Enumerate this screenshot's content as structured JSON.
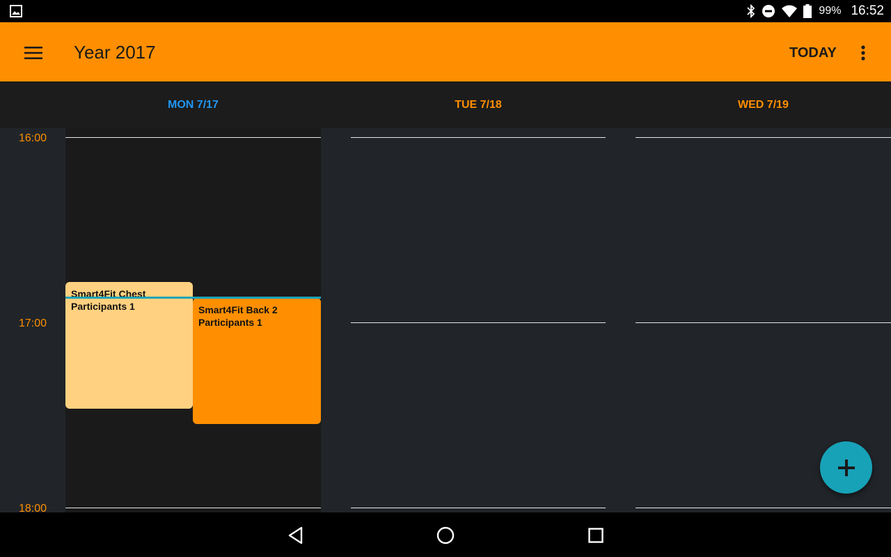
{
  "status_bar": {
    "battery_percent": "99%",
    "time": "16:52",
    "icons": [
      "image-icon",
      "bluetooth-icon",
      "do-not-disturb-icon",
      "wifi-icon",
      "battery-icon"
    ]
  },
  "app_bar": {
    "title": "Year 2017",
    "today_label": "TODAY"
  },
  "colors": {
    "accent": "#FF8F00",
    "today_header": "#2196F3",
    "fab": "#17a2b8",
    "now_line": "#1aa3b8",
    "event_light": "#FFD180",
    "event_dark": "#FF8F00"
  },
  "days": [
    {
      "label": "MON 7/17",
      "is_today": true
    },
    {
      "label": "TUE 7/18",
      "is_today": false
    },
    {
      "label": "WED 7/19",
      "is_today": false
    }
  ],
  "time_labels": [
    "16:00",
    "17:00",
    "18:00"
  ],
  "events": [
    {
      "title": "Smart4Fit Chest",
      "participants": "Participants 1",
      "day": "MON 7/17"
    },
    {
      "title": "Smart4Fit Back 2",
      "participants": "Participants 1",
      "day": "MON 7/17"
    }
  ],
  "fab": {
    "icon": "plus-icon"
  },
  "nav_bar": {
    "icons": [
      "back-icon",
      "home-icon",
      "recents-icon"
    ]
  }
}
